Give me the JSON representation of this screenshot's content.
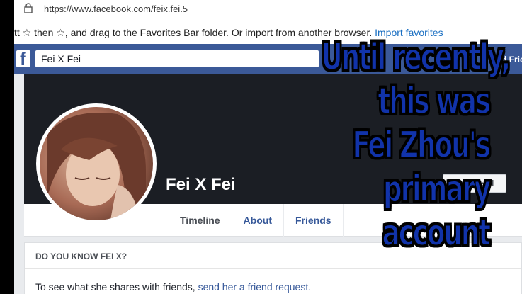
{
  "browser": {
    "url": "https://www.facebook.com/feix.fei.5",
    "favorites_hint": "tt ☆ then ☆, and drag to the Favorites Bar folder. Or import from another browser.",
    "import_link": "Import favorites"
  },
  "fb": {
    "logo": "f",
    "search_value": "Fei X Fei",
    "find_friends": "Find Frie"
  },
  "profile": {
    "name": "Fei X Fei",
    "add_friend": "Add Friend",
    "tabs": [
      "Timeline",
      "About",
      "Friends"
    ]
  },
  "know_box": {
    "heading": "DO YOU KNOW FEI X?",
    "text": "To see what she shares with friends,",
    "link": "send her a friend request."
  },
  "caption": {
    "lines": [
      "Until recently,",
      "this was",
      "Fei Zhou's",
      "primary",
      "account"
    ]
  },
  "colors": {
    "fb_blue": "#3b5998",
    "cover": "#1b1e24",
    "caption_fill": "#1133aa",
    "link": "#365899"
  }
}
